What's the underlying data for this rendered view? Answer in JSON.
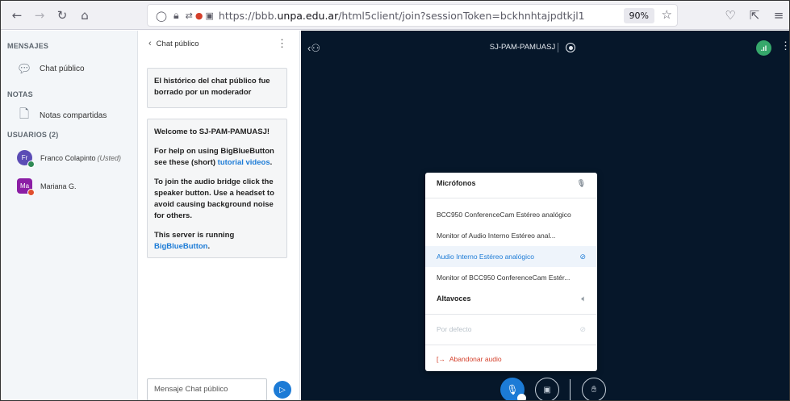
{
  "browser": {
    "url_prefix": "https://bbb.",
    "url_host": "unpa.edu.ar",
    "url_path": "/html5client/join?sessionToken=bckhnhtajpdtkjl1",
    "zoom": "90%"
  },
  "sidebar": {
    "messages_title": "MENSAJES",
    "public_chat_label": "Chat público",
    "notes_title": "NOTAS",
    "shared_notes_label": "Notas compartidas",
    "users_title": "USUARIOS (2)",
    "users": [
      {
        "initials": "Fr",
        "name": "Franco Colapinto",
        "suffix": "(Usted)",
        "color": "#5b4cb5",
        "badge_color": "#2f8a55"
      },
      {
        "initials": "Ma",
        "name": "Mariana G.",
        "suffix": "",
        "color": "#8b1ea5",
        "badge_color": "#e04f2e"
      }
    ]
  },
  "chat": {
    "header_label": "Chat público",
    "cleared_msg": "El histórico del chat público fue borrado por un moderador",
    "welcome_prefix": "Welcome to ",
    "welcome_room": "SJ-PAM-PAMUASJ",
    "welcome_suffix": "!",
    "help_text": "For help on using BigBlueButton see these (short) ",
    "help_link": "tutorial videos",
    "help_end": ".",
    "audio_text": "To join the audio bridge click the speaker button. Use a headset to avoid causing background noise for others.",
    "server_text": "This server is running ",
    "server_link": "BigBlueButton",
    "server_end": ".",
    "input_placeholder": "Mensaje Chat público"
  },
  "main": {
    "room_title": "SJ-PAM-PAMUASJ"
  },
  "audio_menu": {
    "microphones_title": "Micrófonos",
    "microphones": [
      {
        "label": "BCC950 ConferenceCam Estéreo analógico",
        "selected": false
      },
      {
        "label": "Monitor of Audio Interno Estéreo anal...",
        "selected": false
      },
      {
        "label": "Audio Interno Estéreo analógico",
        "selected": true
      },
      {
        "label": "Monitor of BCC950 ConferenceCam Estér...",
        "selected": false
      }
    ],
    "speakers_title": "Altavoces",
    "speaker_default": "Por defecto",
    "leave_audio": "Abandonar audio"
  },
  "icons": {
    "mic": "microphone-icon",
    "speaker": "speaker-icon",
    "check": "check-icon",
    "leave": "leave-audio-icon"
  }
}
